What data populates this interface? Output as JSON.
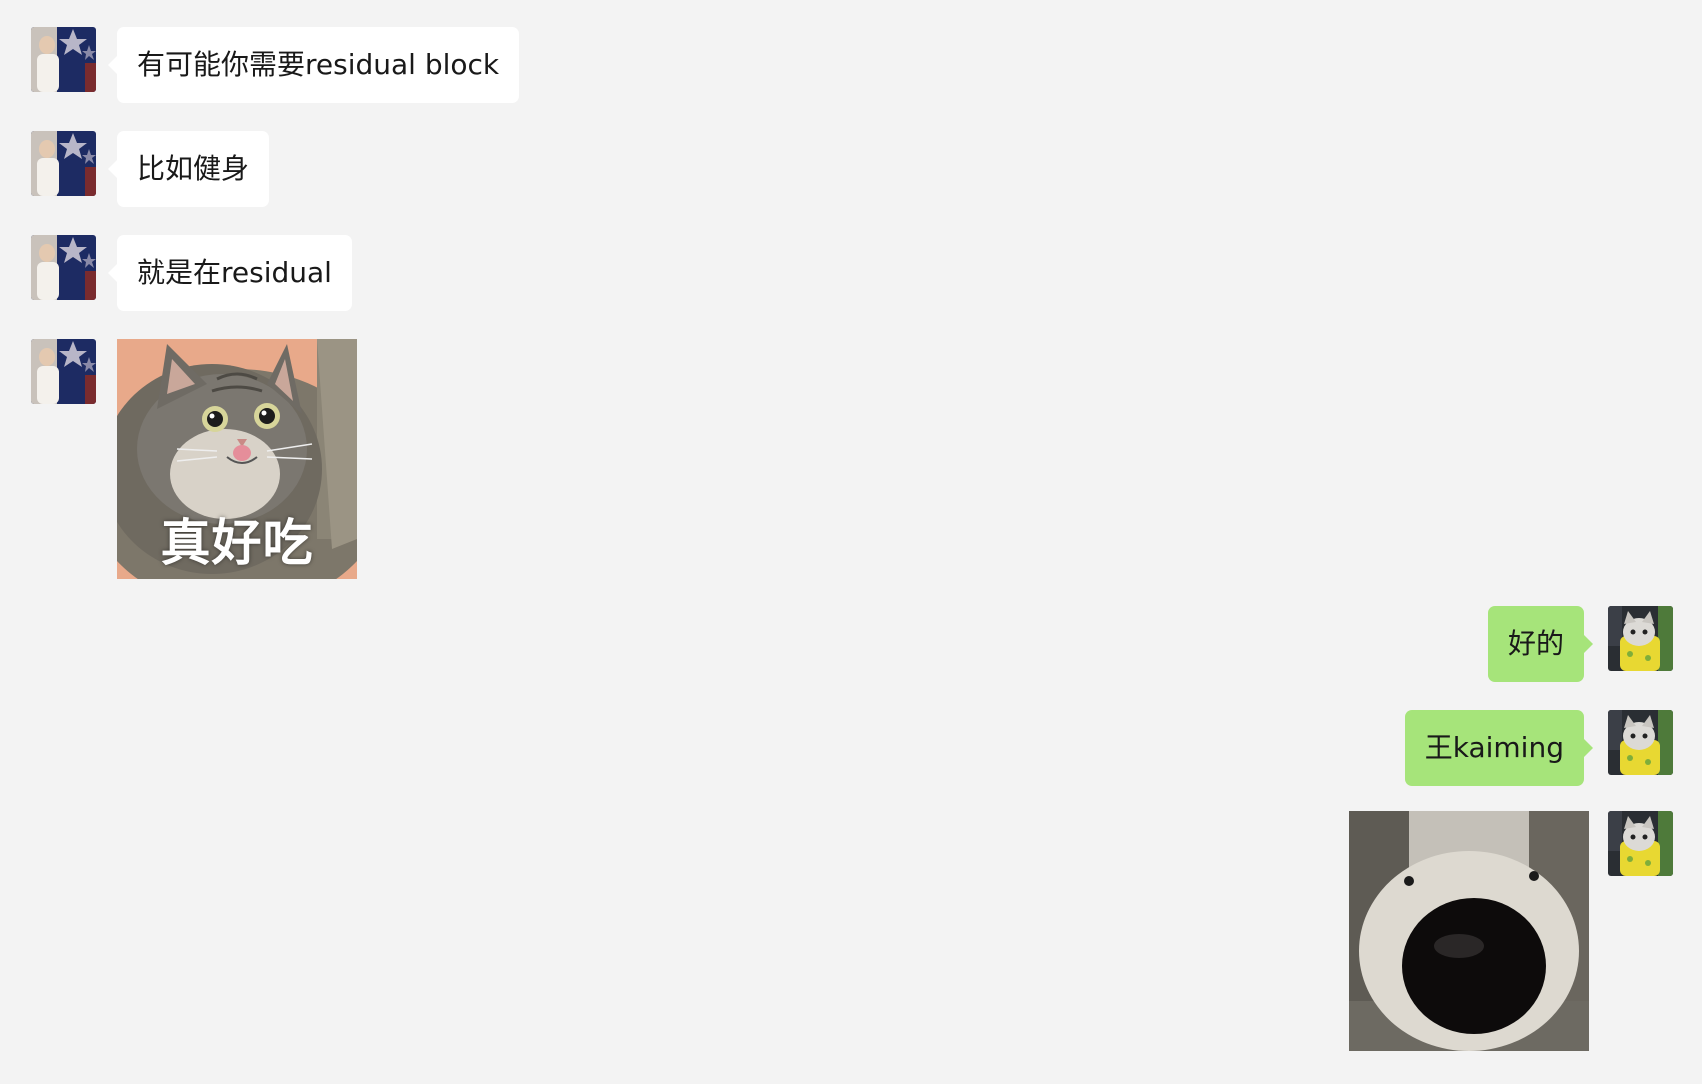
{
  "chat": {
    "messages": [
      {
        "side": "left",
        "type": "text",
        "text": "有可能你需要residual block",
        "avatar": "contact-avatar"
      },
      {
        "side": "left",
        "type": "text",
        "text": "比如健身",
        "avatar": "contact-avatar"
      },
      {
        "side": "left",
        "type": "text",
        "text": "就是在residual",
        "avatar": "contact-avatar"
      },
      {
        "side": "left",
        "type": "sticker",
        "sticker": "cat-licking-sticker",
        "caption": "真好吃",
        "avatar": "contact-avatar"
      },
      {
        "side": "right",
        "type": "text",
        "text": "好的",
        "avatar": "self-avatar"
      },
      {
        "side": "right",
        "type": "text",
        "text": "王kaiming",
        "avatar": "self-avatar"
      },
      {
        "side": "right",
        "type": "sticker",
        "sticker": "dog-nose-sticker",
        "caption": "",
        "avatar": "self-avatar"
      }
    ]
  },
  "colors": {
    "background": "#f3f3f3",
    "incoming_bubble": "#ffffff",
    "outgoing_bubble": "#a6e47a",
    "text": "#191919"
  }
}
